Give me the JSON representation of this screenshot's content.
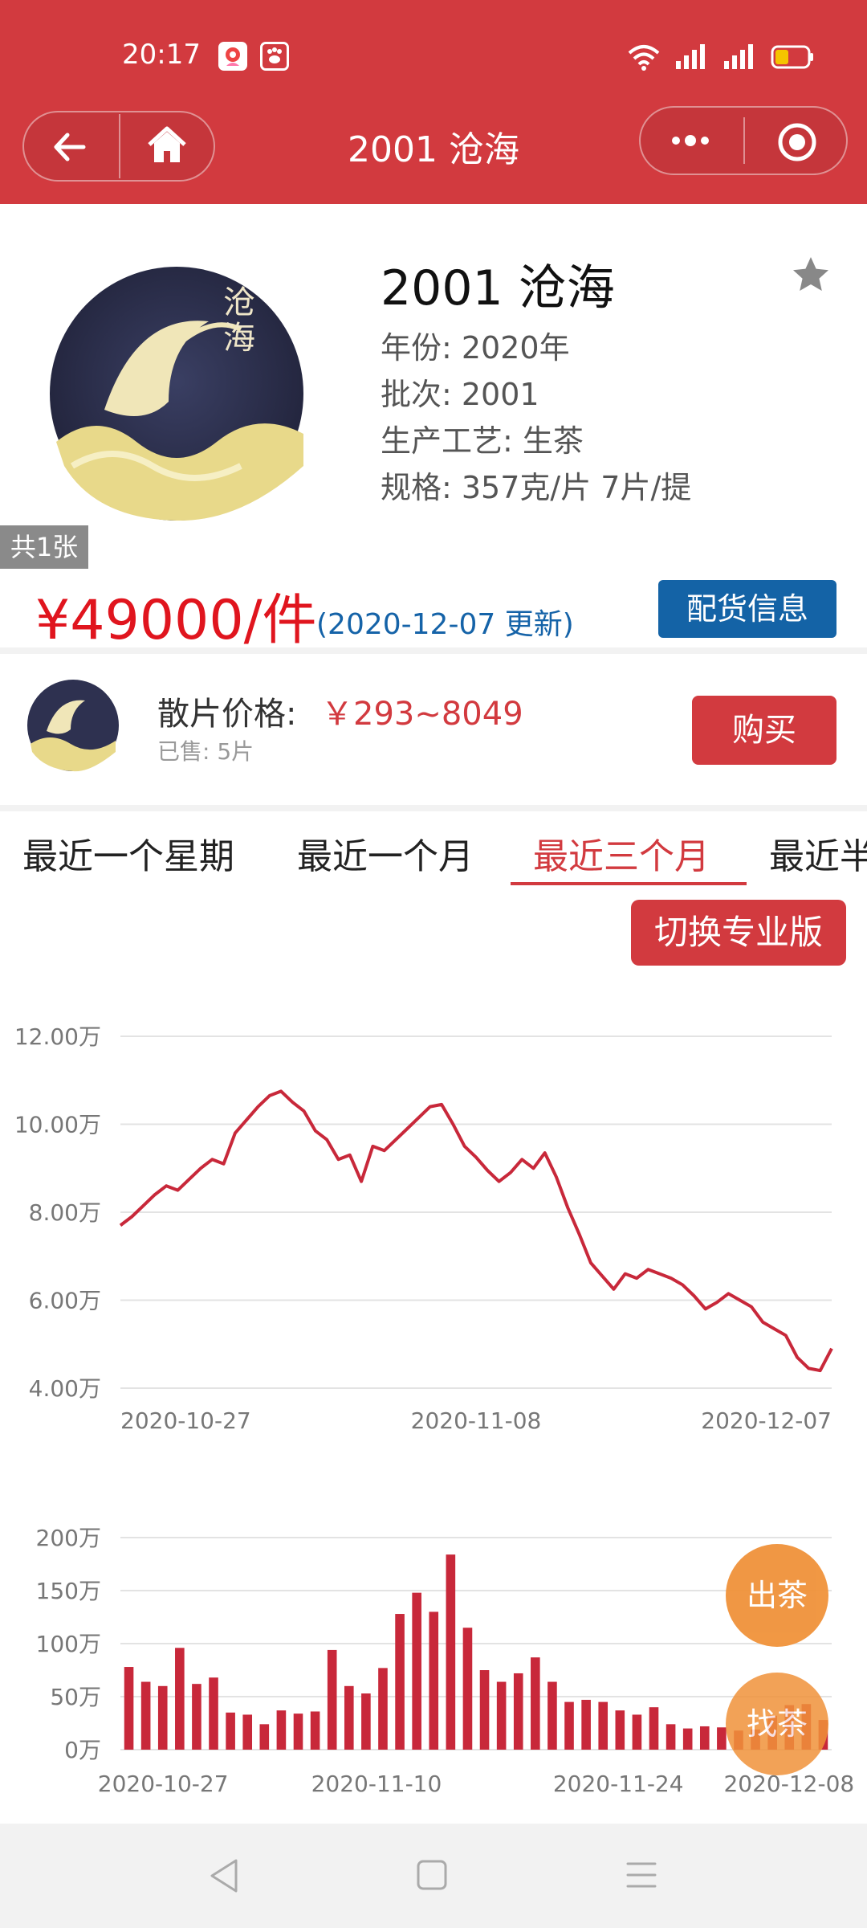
{
  "status": {
    "time": "20:17"
  },
  "header": {
    "title": "2001 沧海"
  },
  "product": {
    "name": "2001 沧海",
    "year": "年份: 2020年",
    "batch": "批次: 2001",
    "process": "生产工艺: 生茶",
    "spec": "规格: 357克/片 7片/提",
    "image_count": "共1张",
    "price": "¥49000/件",
    "updated": "(2020-12-07 更新)",
    "distribution_button": "配货信息"
  },
  "loose": {
    "label": "散片价格:",
    "range": "￥293~8049",
    "sold": "已售: 5片",
    "buy_button": "购买"
  },
  "tabs": [
    "最近一个星期",
    "最近一个月",
    "最近三个月",
    "最近半"
  ],
  "active_tab_index": 2,
  "pro_button": "切换专业版",
  "floating": {
    "sell": "出茶",
    "find": "找茶"
  },
  "colors": {
    "brand_red": "#d23a3f",
    "price_red": "#e0151e",
    "blue": "#1463a6",
    "orange": "#f0923a"
  },
  "chart_data": [
    {
      "type": "line",
      "y_tick_labels": [
        "12.00万",
        "10.00万",
        "8.00万",
        "6.00万",
        "4.00万"
      ],
      "ylim": [
        40000,
        120000
      ],
      "x_tick_labels": [
        "2020-10-27",
        "2020-11-08",
        "2020-12-07"
      ],
      "series": [
        {
          "values": [
            77000,
            79000,
            81500,
            84000,
            86000,
            85000,
            87500,
            90000,
            92000,
            91000,
            98000,
            101000,
            104000,
            106500,
            107500,
            105000,
            103000,
            98500,
            96500,
            92000,
            93000,
            87000,
            95000,
            94000,
            96500,
            99000,
            101500,
            104000,
            104500,
            100000,
            95000,
            92500,
            89500,
            87000,
            89000,
            92000,
            90000,
            93500,
            88000,
            81000,
            75000,
            68500,
            65500,
            62500,
            66000,
            65000,
            67000,
            66000,
            65000,
            63500,
            61000,
            58000,
            59500,
            61500,
            60000,
            58500,
            55000,
            53500,
            52000,
            47000,
            44500,
            44000,
            49000
          ]
        }
      ]
    },
    {
      "type": "bar",
      "y_tick_labels": [
        "200万",
        "150万",
        "100万",
        "50万",
        "0万"
      ],
      "ylim": [
        0,
        2000000
      ],
      "x_tick_labels": [
        "2020-10-27",
        "2020-11-10",
        "2020-11-24",
        "2020-12-08"
      ],
      "values": [
        780000,
        640000,
        600000,
        960000,
        620000,
        680000,
        350000,
        330000,
        240000,
        370000,
        340000,
        360000,
        940000,
        600000,
        530000,
        770000,
        1280000,
        1480000,
        1300000,
        1840000,
        1150000,
        750000,
        640000,
        720000,
        870000,
        640000,
        450000,
        470000,
        450000,
        370000,
        330000,
        400000,
        240000,
        200000,
        220000,
        210000,
        180000,
        190000,
        320000,
        420000,
        430000,
        280000
      ]
    }
  ]
}
